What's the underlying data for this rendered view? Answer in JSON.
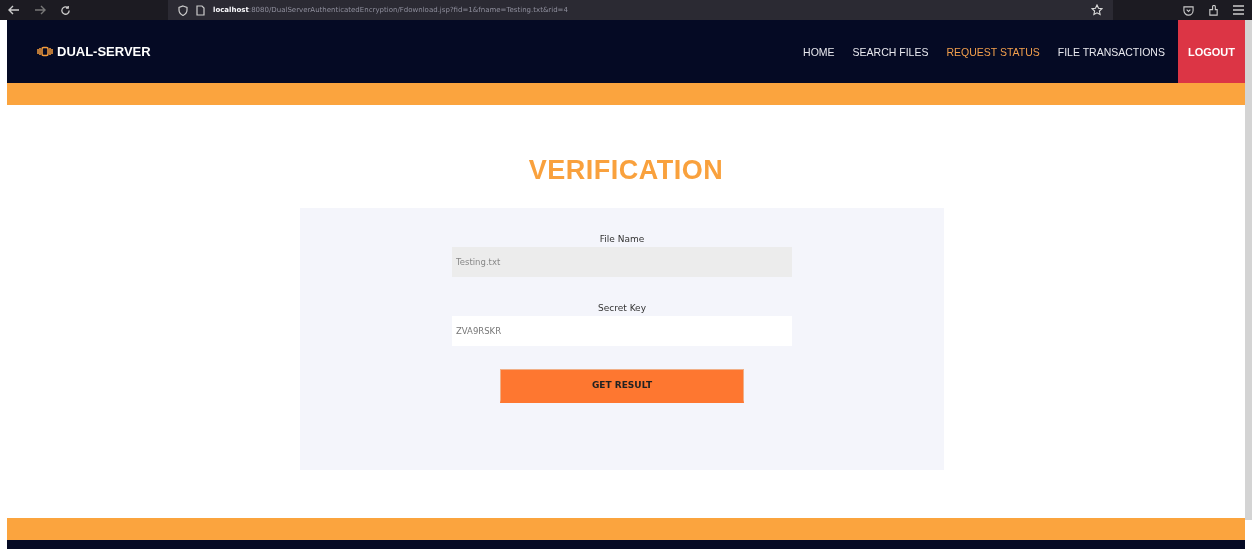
{
  "browser": {
    "url_host": "localhost",
    "url_rest": ":8080/DualServerAuthenticatedEncryption/Fdownload.jsp?fid=1&fname=Testing.txt&rid=4"
  },
  "brand": "DUAL-SERVER",
  "nav": [
    {
      "label": "HOME",
      "selected": false
    },
    {
      "label": "SEARCH FILES",
      "selected": false
    },
    {
      "label": "REQUEST STATUS",
      "selected": true
    },
    {
      "label": "FILE TRANSACTIONS",
      "selected": false
    }
  ],
  "logout": "LOGOUT",
  "title": "VERIFICATION",
  "fields": [
    {
      "label": "File Name",
      "value": "Testing.txt",
      "disabled": true
    },
    {
      "label": "Secret Key",
      "value": "ZVA9RSKR",
      "disabled": false
    }
  ],
  "submit": "GET RESULT"
}
